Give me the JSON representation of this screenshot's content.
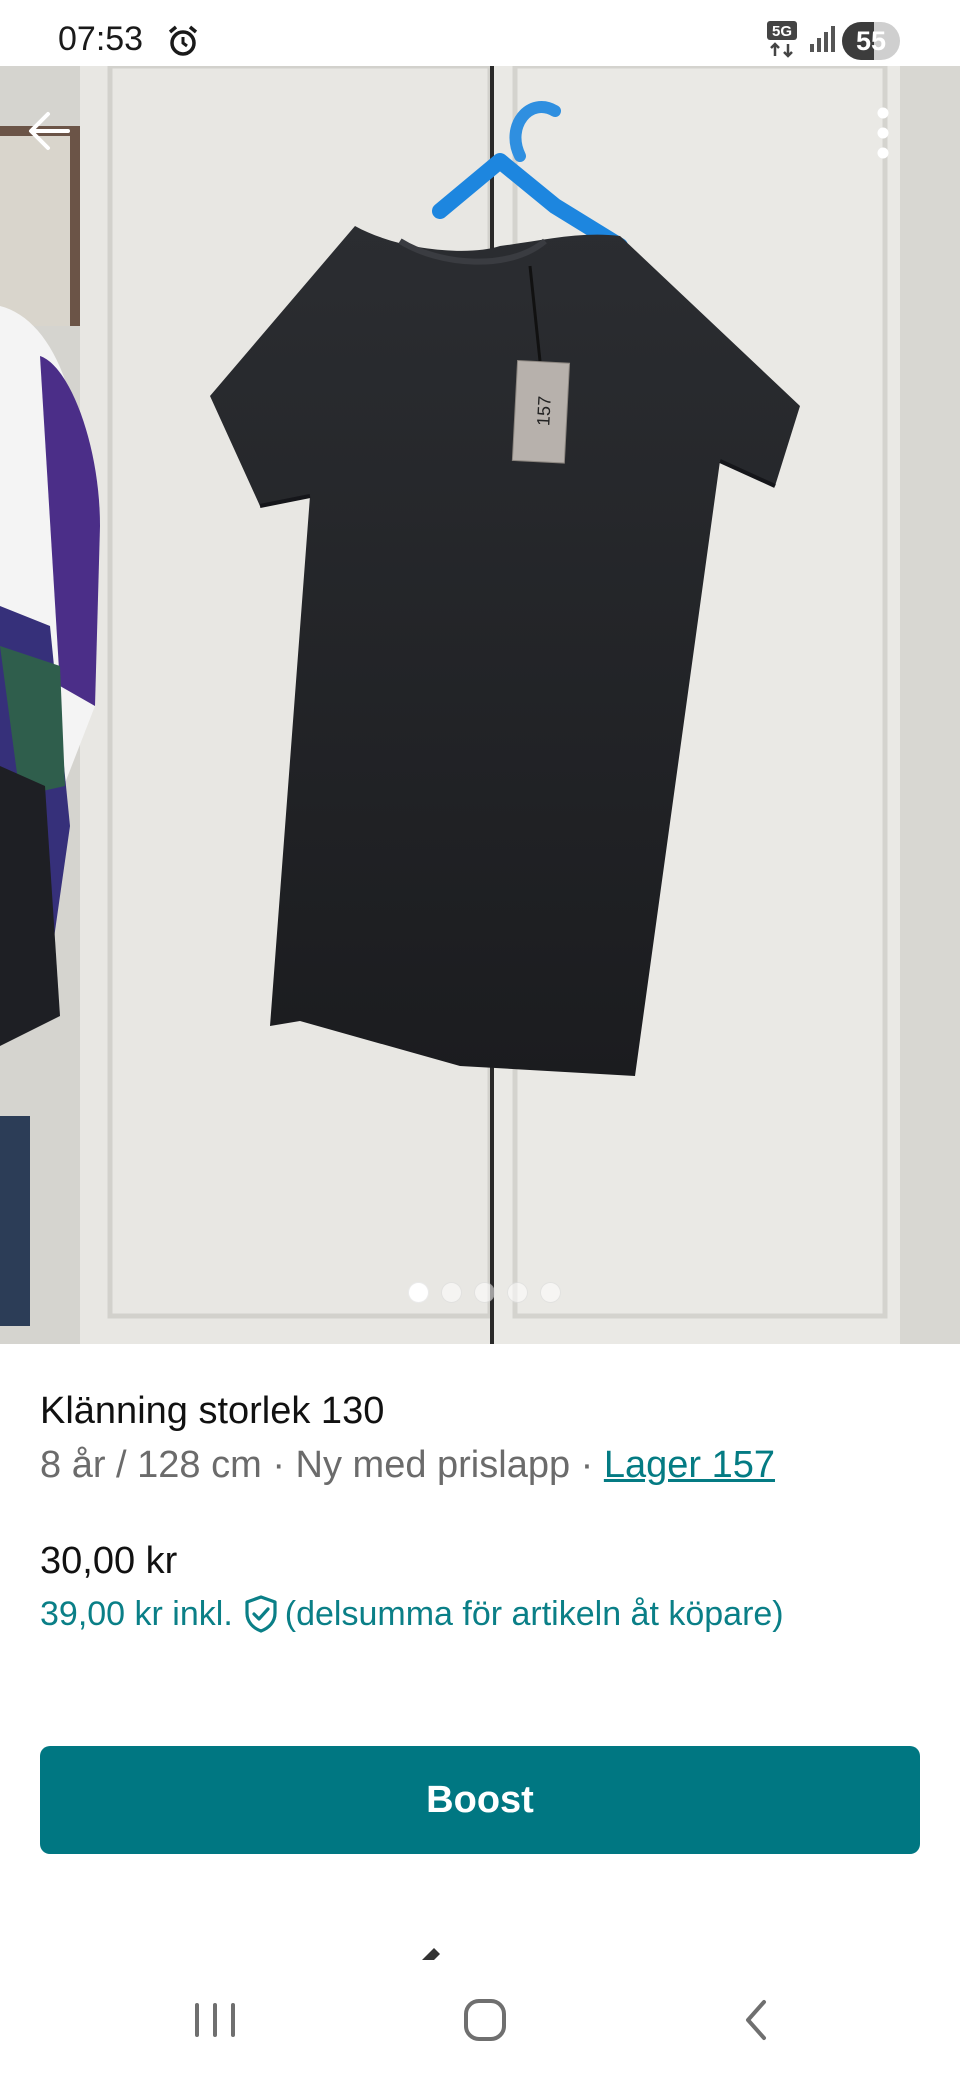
{
  "status_bar": {
    "time": "07:53",
    "network": "5G",
    "battery": "55",
    "battery_level": 0.55
  },
  "gallery": {
    "image_count": 5,
    "active_index": 0,
    "tag_text": "157"
  },
  "item": {
    "title": "Klänning storlek 130",
    "details": "8 år / 128 cm · Ny med prislapp · ",
    "brand": "Lager 157",
    "price": "30,00 kr",
    "price_incl": "39,00 kr  inkl.",
    "price_incl_note": "(delsumma för artikeln åt köpare)"
  },
  "actions": {
    "boost_label": "Boost"
  },
  "colors": {
    "accent": "#007782",
    "link": "#047b83"
  },
  "icons": {
    "back": "arrow-left-icon",
    "more": "more-vertical-icon",
    "buyer_protection": "shield-check-icon",
    "alarm": "alarm-icon",
    "signal": "signal-icon",
    "nav_recents": "recents-icon",
    "nav_home": "home-icon",
    "nav_back": "back-chevron-icon"
  }
}
